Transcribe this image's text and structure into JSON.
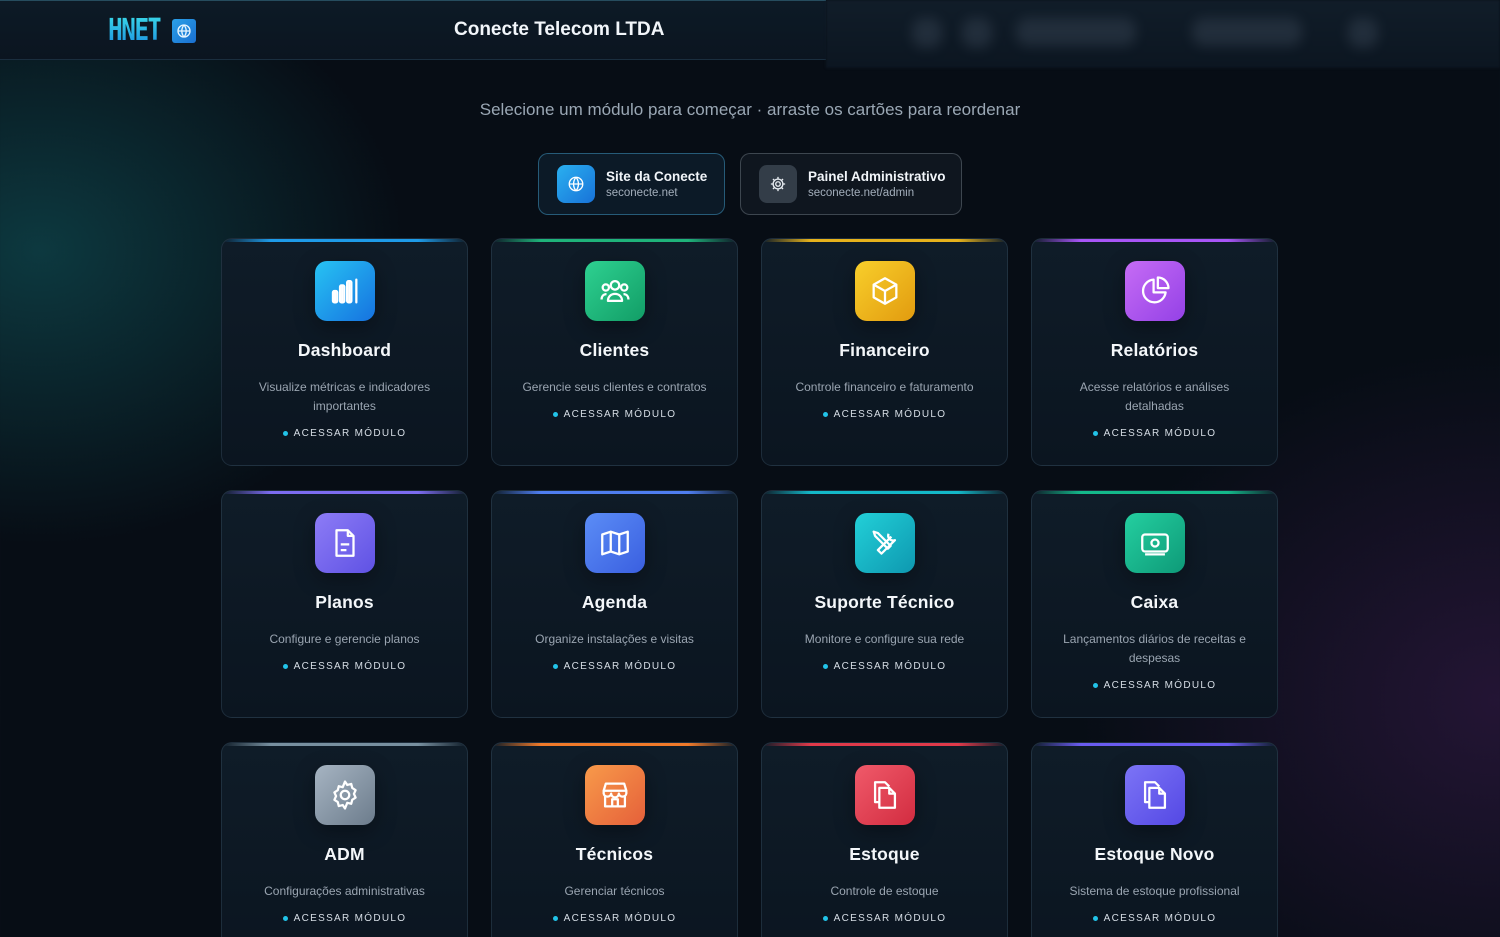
{
  "header": {
    "logo_text": "HNET",
    "company_name": "Conecte Telecom LTDA"
  },
  "main": {
    "subtitle": "Selecione um módulo para começar · arraste os cartões para reordenar",
    "quick_links": [
      {
        "title": "Site da Conecte",
        "url": "seconecte.net",
        "icon": "globe-icon"
      },
      {
        "title": "Painel Administrativo",
        "url": "seconecte.net/admin",
        "icon": "gear-icon"
      }
    ],
    "cta_label": "ACESSAR MÓDULO",
    "modules": [
      {
        "title": "Dashboard",
        "description": "Visualize métricas e indicadores importantes",
        "icon": "bar-chart-icon",
        "accent": "#1e9be8",
        "gradient": [
          "#27c3f3",
          "#1672e0"
        ]
      },
      {
        "title": "Clientes",
        "description": "Gerencie seus clientes e contratos",
        "icon": "users-icon",
        "accent": "#1fb37a",
        "gradient": [
          "#2ed191",
          "#129d66"
        ]
      },
      {
        "title": "Financeiro",
        "description": "Controle financeiro e faturamento",
        "icon": "box-icon",
        "accent": "#e6b21c",
        "gradient": [
          "#f8cf2b",
          "#e29b0f"
        ]
      },
      {
        "title": "Relatórios",
        "description": "Acesse relatórios e análises detalhadas",
        "icon": "pie-chart-icon",
        "accent": "#a855f7",
        "gradient": [
          "#c66cf5",
          "#9441e6"
        ]
      },
      {
        "title": "Planos",
        "description": "Configure e gerencie planos",
        "icon": "document-icon",
        "accent": "#7c6cf0",
        "gradient": [
          "#8d7cf6",
          "#5f52e4"
        ]
      },
      {
        "title": "Agenda",
        "description": "Organize instalações e visitas",
        "icon": "map-icon",
        "accent": "#4f7ef0",
        "gradient": [
          "#5b8df6",
          "#3a5fe0"
        ]
      },
      {
        "title": "Suporte Técnico",
        "description": "Monitore e configure sua rede",
        "icon": "tools-icon",
        "accent": "#14b8c8",
        "gradient": [
          "#22d0d8",
          "#0e98b0"
        ]
      },
      {
        "title": "Caixa",
        "description": "Lançamentos diários de receitas e despesas",
        "icon": "cash-icon",
        "accent": "#14b88a",
        "gradient": [
          "#24cfa0",
          "#0e9a78"
        ]
      },
      {
        "title": "ADM",
        "description": "Configurações administrativas",
        "icon": "settings-icon",
        "accent": "#7890a0",
        "gradient": [
          "#a6b4c2",
          "#6c7c8c"
        ]
      },
      {
        "title": "Técnicos",
        "description": "Gerenciar técnicos",
        "icon": "store-icon",
        "accent": "#f07a2a",
        "gradient": [
          "#f89a4a",
          "#e5603a"
        ]
      },
      {
        "title": "Estoque",
        "description": "Controle de estoque",
        "icon": "copy-icon",
        "accent": "#e03a4a",
        "gradient": [
          "#f05a6a",
          "#d22c40"
        ]
      },
      {
        "title": "Estoque Novo",
        "description": "Sistema de estoque profissional",
        "icon": "copy-icon",
        "accent": "#6a5cf0",
        "gradient": [
          "#7c74f6",
          "#5448e4"
        ]
      }
    ]
  }
}
